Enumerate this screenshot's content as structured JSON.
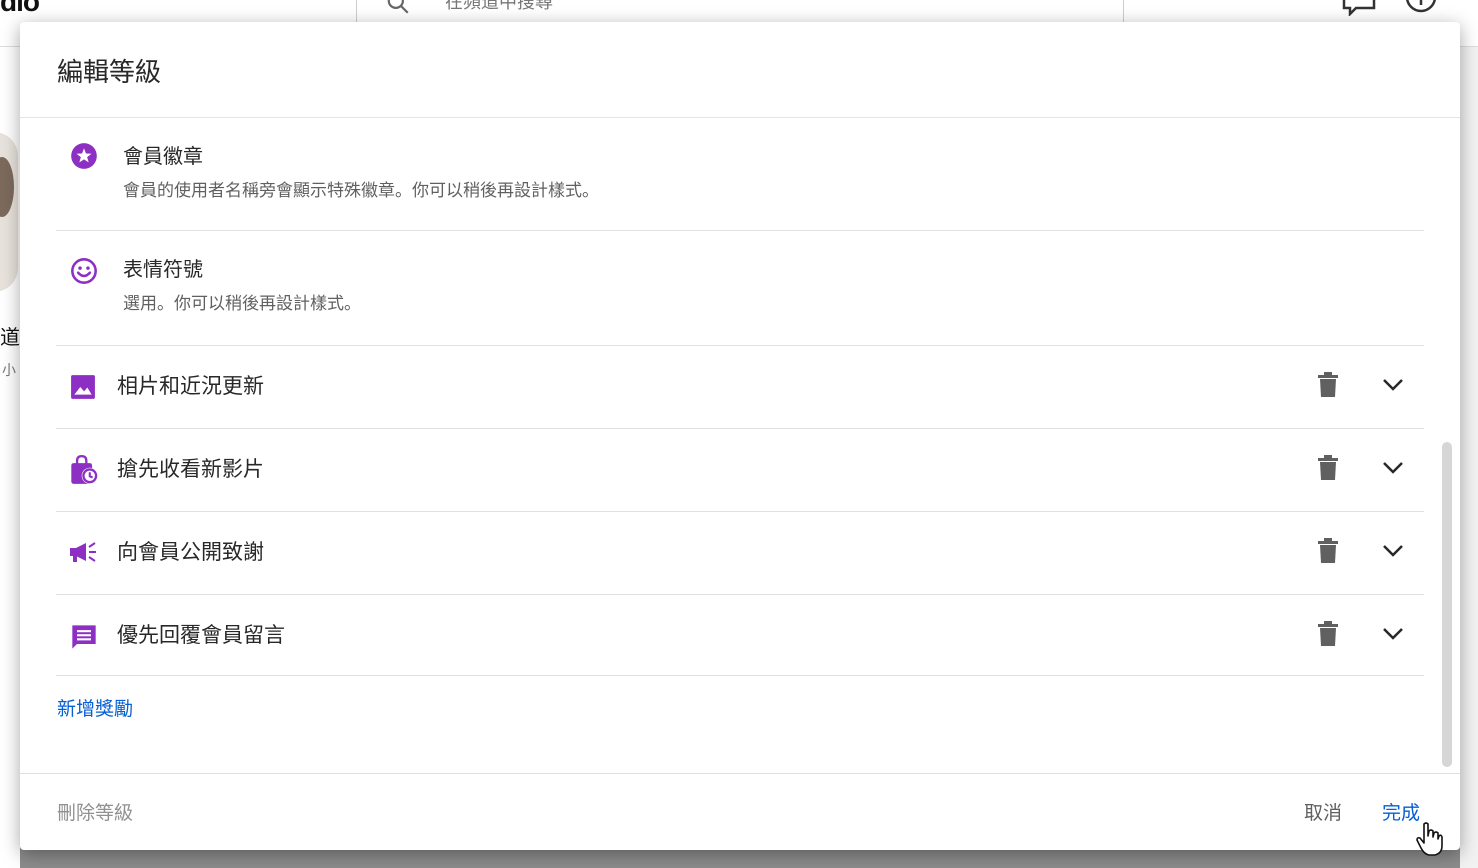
{
  "background": {
    "logo_text": "dio",
    "search_placeholder": "在頻道中搜尋",
    "channel_name_fragment": "道",
    "channel_sub_fragment": "小"
  },
  "dialog": {
    "title": "編輯等級",
    "perks": [
      {
        "title": "會員徽章",
        "description": "會員的使用者名稱旁會顯示特殊徽章。你可以稍後再設計樣式。",
        "icon": "star-badge-icon"
      },
      {
        "title": "表情符號",
        "description": "選用。你可以稍後再設計樣式。",
        "icon": "smiley-icon"
      }
    ],
    "rewards": [
      {
        "title": "相片和近況更新",
        "icon": "image-icon"
      },
      {
        "title": "搶先收看新影片",
        "icon": "bag-clock-icon"
      },
      {
        "title": "向會員公開致謝",
        "icon": "megaphone-icon"
      },
      {
        "title": "優先回覆會員留言",
        "icon": "comment-icon"
      }
    ],
    "add_reward": "新增獎勵",
    "footer": {
      "delete_tier": "刪除等級",
      "cancel": "取消",
      "done": "完成"
    }
  },
  "colors": {
    "accent_purple": "#8e2fc3",
    "link_blue": "#065fd4",
    "icon_gray": "#606060",
    "overlay": "#8c8c8c"
  }
}
